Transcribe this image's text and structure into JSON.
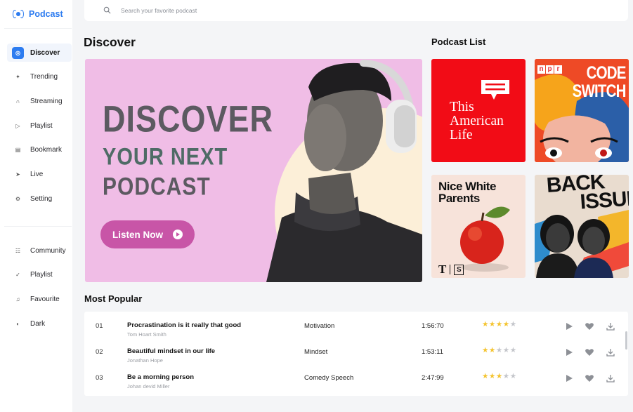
{
  "brand": {
    "name": "Podcast"
  },
  "search": {
    "placeholder": "Search your favorite podcast"
  },
  "sidebar": {
    "primary": [
      {
        "label": "Discover",
        "icon": "compass-icon",
        "active": true
      },
      {
        "label": "Trending",
        "icon": "bulb-icon"
      },
      {
        "label": "Streaming",
        "icon": "headphones-icon"
      },
      {
        "label": "Playlist",
        "icon": "play-outline-icon"
      },
      {
        "label": "Bookmark",
        "icon": "bookmark-icon"
      },
      {
        "label": "Live",
        "icon": "send-icon"
      },
      {
        "label": "Setting",
        "icon": "gear-icon"
      }
    ],
    "secondary": [
      {
        "label": "Community",
        "icon": "people-icon"
      },
      {
        "label": "Playlist",
        "icon": "check-circle-icon"
      },
      {
        "label": "Favourite",
        "icon": "music-note-icon"
      },
      {
        "label": "Dark",
        "icon": "moon-icon"
      }
    ]
  },
  "discover": {
    "title": "Discover",
    "hero": {
      "line1": "DISCOVER",
      "line2": "YOUR NEXT",
      "line3": "PODCAST",
      "button_label": "Listen Now"
    }
  },
  "podcast_list": {
    "title": "Podcast List",
    "cards": [
      {
        "name": "This American Life",
        "line1": "This",
        "line2": "American",
        "line3": "Life"
      },
      {
        "name": "Code Switch",
        "badge": [
          "n",
          "p",
          "r"
        ],
        "line1": "CODE",
        "line2": "SWITCH"
      },
      {
        "name": "Nice White Parents",
        "line1": "Nice White",
        "line2": "Parents",
        "logo_t": "T",
        "logo_s": "S"
      },
      {
        "name": "Back Issues",
        "line1": "BACK",
        "line2": "ISSUI"
      }
    ]
  },
  "most_popular": {
    "title": "Most Popular",
    "rows": [
      {
        "num": "01",
        "title": "Procrastination is it really that good",
        "author": "Tom Hoart Smith",
        "category": "Motivation",
        "duration": "1:56:70",
        "rating": 4
      },
      {
        "num": "02",
        "title": "Beautiful mindset in our life",
        "author": "Jonathan Hope",
        "category": "Mindset",
        "duration": "1:53:11",
        "rating": 2
      },
      {
        "num": "03",
        "title": "Be a morning person",
        "author": "Johan devid Miller",
        "category": "Comedy Speech",
        "duration": "2:47:99",
        "rating": 3
      }
    ]
  },
  "colors": {
    "accent": "#2d7cf0",
    "hero_bg": "#f0bde6",
    "listen_button": "#c855a7",
    "star": "#f4c430"
  }
}
